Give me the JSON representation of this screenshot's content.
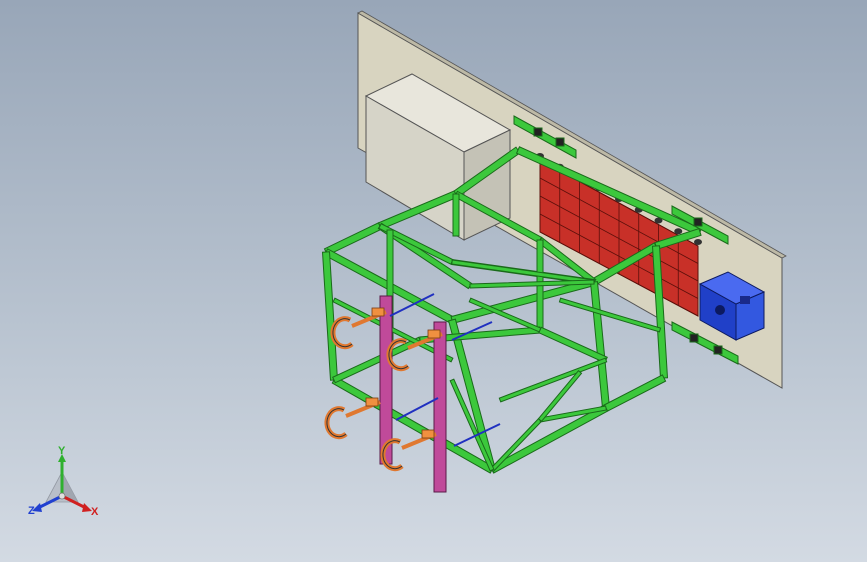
{
  "viewport": {
    "background_top": "#98a6b8",
    "background_bottom": "#d3dae3"
  },
  "model": {
    "frame_color": "#3cc83c",
    "frame_dark": "#1f7a1f",
    "wall_color": "#d8d4c0",
    "box_color": "#dedcd2",
    "grid_color": "#d0302a",
    "motor_color": "#2040c8",
    "tool_color": "#e07830",
    "plate_color": "#c04a9a"
  },
  "triad": {
    "y_label": "Y",
    "x_label": "X",
    "z_label": "Z",
    "y_color": "#2fb02f",
    "x_color": "#d02020",
    "z_color": "#2040d0"
  }
}
